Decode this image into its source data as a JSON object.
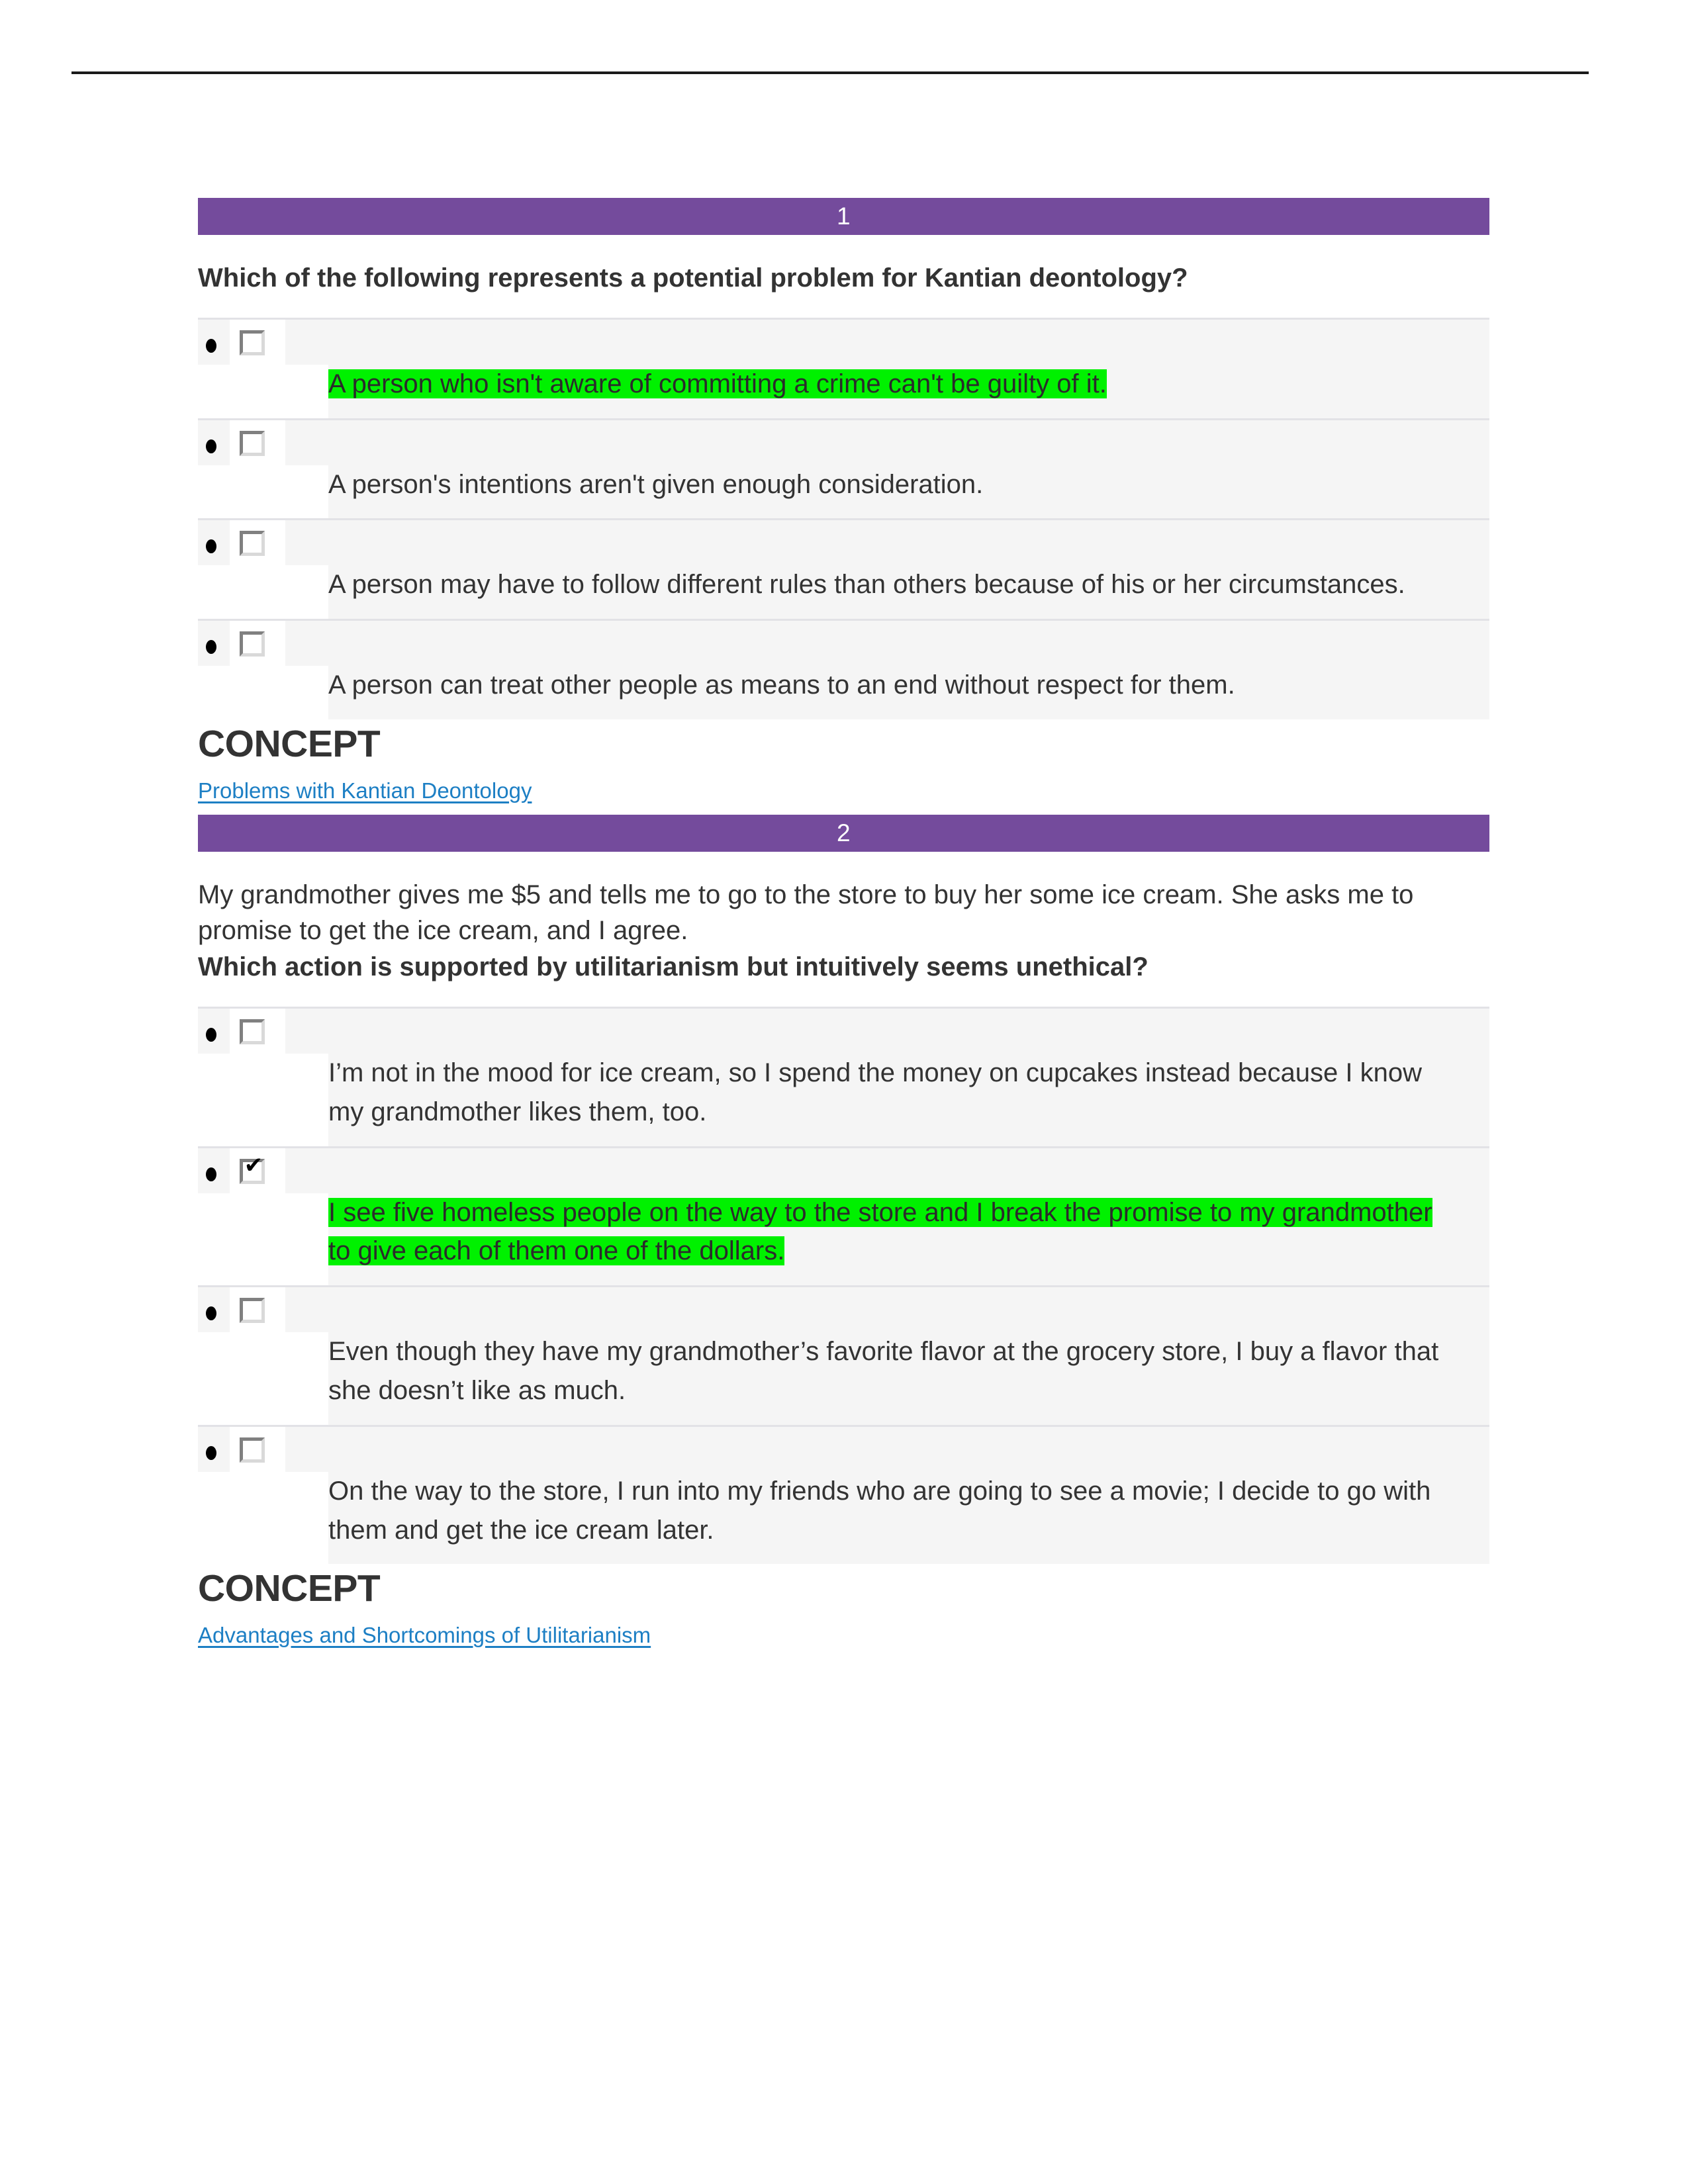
{
  "document": {
    "title": "Ethics Quiz Results",
    "accent_purple": "#744B9C",
    "highlight_green": "#00F100",
    "link_blue": "#1D7FC4",
    "row_background": "#f5f5f5"
  },
  "questions": [
    {
      "number": "1",
      "prompt_plain": "",
      "prompt_bold": "Which of the following represents a potential problem for Kantian deontology?",
      "options": [
        {
          "text": "A person who isn't aware of committing a crime can't be guilty of it.",
          "checked": false,
          "highlighted": true
        },
        {
          "text": "A person's intentions aren't given enough consideration.",
          "checked": false,
          "highlighted": false
        },
        {
          "text": "A person may have to follow different rules than others because of his or her circumstances.",
          "checked": false,
          "highlighted": false
        },
        {
          "text": "A person can treat other people as means to an end without respect for them.",
          "checked": false,
          "highlighted": false
        }
      ],
      "concept_heading": "CONCEPT",
      "concept_link": "Problems with Kantian Deontology"
    },
    {
      "number": "2",
      "prompt_plain": "My grandmother gives me $5 and tells me to go to the store to buy her some ice cream. She asks me to promise to get the ice cream, and I agree.",
      "prompt_bold": "Which action is supported by utilitarianism but intuitively seems unethical?",
      "options": [
        {
          "text": "I’m not in the mood for ice cream, so I spend the money on cupcakes instead because I know my grandmother likes them, too.",
          "checked": false,
          "highlighted": false
        },
        {
          "text": "I see five homeless people on the way to the store and I break the promise to my grandmother to give each of them one of the dollars.",
          "checked": true,
          "highlighted": true
        },
        {
          "text": "Even though they have my grandmother’s favorite flavor at the grocery store, I buy a flavor that she doesn’t like as much.",
          "checked": false,
          "highlighted": false
        },
        {
          "text": "On the way to the store, I run into my friends who are going to see a movie; I decide to go with them and get the ice cream later.",
          "checked": false,
          "highlighted": false
        }
      ],
      "concept_heading": "CONCEPT",
      "concept_link": "Advantages and Shortcomings of Utilitarianism"
    }
  ],
  "icons": {
    "checkbox_checked_glyph": "✔",
    "bullet_glyph": "•"
  }
}
